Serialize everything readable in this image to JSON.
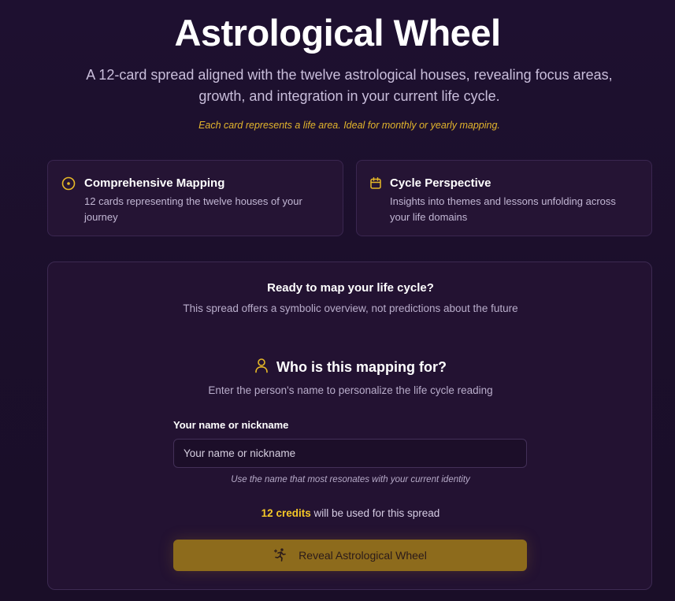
{
  "header": {
    "title": "Astrological Wheel",
    "subtitle": "A 12-card spread aligned with the twelve astrological houses, revealing focus areas, growth, and integration in your current life cycle.",
    "note": "Each card represents a life area. Ideal for monthly or yearly mapping."
  },
  "features": [
    {
      "icon": "target-circle-icon",
      "title": "Comprehensive Mapping",
      "description": "12 cards representing the twelve houses of your journey"
    },
    {
      "icon": "calendar-icon",
      "title": "Cycle Perspective",
      "description": "Insights into themes and lessons unfolding across your life domains"
    }
  ],
  "panel": {
    "ready_title": "Ready to map your life cycle?",
    "ready_subtitle": "This spread offers a symbolic overview, not predictions about the future",
    "who_icon": "user-icon",
    "who_title": "Who is this mapping for?",
    "who_subtitle": "Enter the person's name to personalize the life cycle reading",
    "field_label": "Your name or nickname",
    "input_value": "",
    "input_placeholder": "Your name or nickname",
    "helper_text": "Use the name that most resonates with your current identity",
    "credits_amount": "12 credits",
    "credits_text": " will be used for this spread",
    "button_icon": "sparkle-figure-icon",
    "button_label": "Reveal Astrological Wheel"
  },
  "colors": {
    "background": "#1c0f2c",
    "accent_gold": "#f5c827",
    "button_bg": "#8d6b1c",
    "card_bg": "#251434"
  }
}
